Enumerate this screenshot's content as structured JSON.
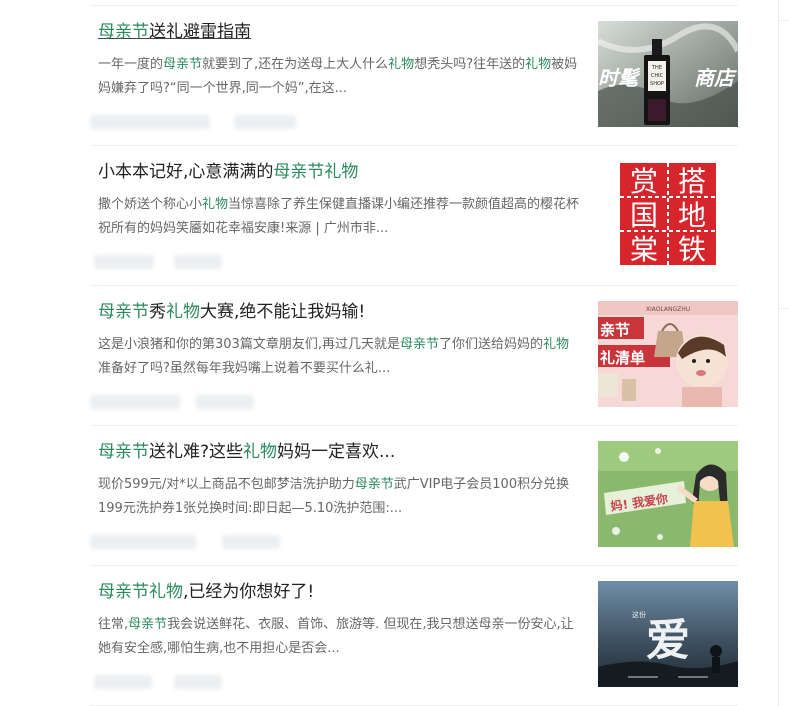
{
  "colors": {
    "highlight": "#2a8a5e",
    "title": "#222222",
    "snippet": "#666666",
    "divider": "#efefef"
  },
  "results": [
    {
      "title": [
        {
          "t": "母亲节",
          "h": true
        },
        {
          "t": "送礼避雷指南",
          "h": false
        }
      ],
      "snippet": [
        {
          "t": "一年一度的",
          "h": false
        },
        {
          "t": "母亲节",
          "h": true
        },
        {
          "t": "就要到了,还在为送母上大人什么",
          "h": false
        },
        {
          "t": "礼物",
          "h": true
        },
        {
          "t": "想秃头吗?往年送的",
          "h": false
        },
        {
          "t": "礼",
          "h": true
        },
        {
          "t": "物",
          "h": true
        },
        {
          "t": "被妈妈嫌弃了吗?“同一个世界,同一个妈”,在这...",
          "h": false
        }
      ],
      "thumb": {
        "theme": "perfume-shop",
        "text1": "时髦",
        "text2": "商店",
        "bottle_label1": "THE",
        "bottle_label2": "CHIC",
        "bottle_label3": "SHOP"
      }
    },
    {
      "title": [
        {
          "t": "小本本记好,心意满满的",
          "h": false
        },
        {
          "t": "母亲节礼物",
          "h": true
        }
      ],
      "snippet": [
        {
          "t": "撒个娇送个称心小",
          "h": false
        },
        {
          "t": "礼物",
          "h": true
        },
        {
          "t": "当惊喜除了养生保健直播课小编还推荐一款颜值超高的樱花杯祝所有的妈妈笑靥如花幸福安康!来源 | 广州市非...",
          "h": false
        }
      ],
      "thumb": {
        "theme": "red-calligraphy",
        "chars": [
          "赏",
          "搭",
          "国",
          "地",
          "棠",
          "铁"
        ]
      }
    },
    {
      "title": [
        {
          "t": "母亲节",
          "h": true
        },
        {
          "t": "秀",
          "h": false
        },
        {
          "t": "礼物",
          "h": true
        },
        {
          "t": "大赛,绝不能让我妈输!",
          "h": false
        }
      ],
      "snippet": [
        {
          "t": "这是小浪猪和你的第303篇文章朋友们,再过几天就是",
          "h": false
        },
        {
          "t": "母亲节",
          "h": true
        },
        {
          "t": "了你们送给妈妈的",
          "h": false
        },
        {
          "t": "礼物",
          "h": true
        },
        {
          "t": "准备好了吗?虽然每年我妈嘴上说着不要买什么礼...",
          "h": false
        }
      ],
      "thumb": {
        "theme": "gift-list",
        "brand": "XIAOLANGZHU",
        "line1": "亲节",
        "line2": "礼清单"
      }
    },
    {
      "title": [
        {
          "t": "母亲节",
          "h": true
        },
        {
          "t": "送礼难?这些",
          "h": false
        },
        {
          "t": "礼物",
          "h": true
        },
        {
          "t": "妈妈一定喜欢...",
          "h": false
        }
      ],
      "snippet": [
        {
          "t": "现价599元/对*以上商品不包邮梦洁洗护助力",
          "h": false
        },
        {
          "t": "母亲节",
          "h": true
        },
        {
          "t": "武广VIP电子会员100积分兑换199元洗护券1张兑换时间:即日起—5.10洗护范围:...",
          "h": false
        }
      ],
      "thumb": {
        "theme": "green-card",
        "text": "妈! 我爱你"
      }
    },
    {
      "title": [
        {
          "t": "母亲节礼物",
          "h": true
        },
        {
          "t": ",已经为你想好了!",
          "h": false
        }
      ],
      "snippet": [
        {
          "t": "往常,",
          "h": false
        },
        {
          "t": "母亲节",
          "h": true
        },
        {
          "t": "我会说送鲜花、衣服、首饰、旅游等. 但现在,我只想送母亲一份安心,让她有安全感,哪怕生病,也不用担心是否会...",
          "h": false
        }
      ],
      "thumb": {
        "theme": "love-poster",
        "small": "这份",
        "big": "爱"
      }
    }
  ]
}
